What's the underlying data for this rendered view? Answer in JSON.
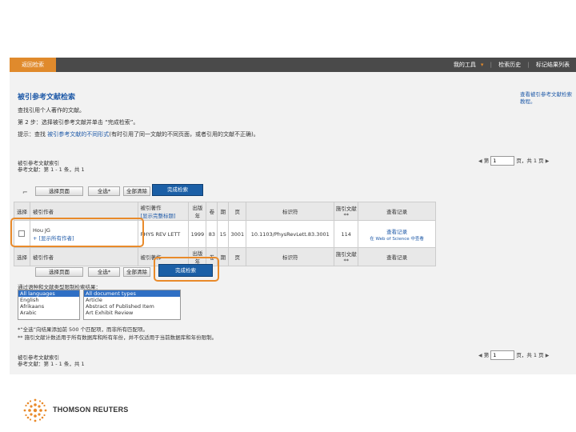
{
  "topbar": {
    "back_label": "返回检索",
    "link_tools": "我的工具",
    "link_history": "检索历史",
    "link_marked": "标记结果列表"
  },
  "page": {
    "title": "被引参考文献检索",
    "help": "查看被引参考文献检索教程。",
    "instructions": {
      "line1": "查找引用个人著作的文献。",
      "line2": "第 2 步：选择被引参考文献并单击 “完成检索”。",
      "line3_prefix": "提示：查找",
      "line3_link": "被引参考文献的不同形式",
      "line3_suffix": "(有时引用了同一文献的不同页面，或者引用的文献不正确)。"
    }
  },
  "counts": {
    "line1": "被引参考文献索引",
    "line2": "参考文献：第 1 - 1 条，共 1"
  },
  "pager": {
    "prefix": "第",
    "page": "1",
    "middle": "页，共 1 页"
  },
  "buttons": {
    "select_page": "选择页面",
    "select_all": "全选*",
    "clear_all": "全部清除",
    "finish": "完成检索"
  },
  "table": {
    "headers": {
      "select": "选择",
      "cited_author": "被引作者",
      "cited_work": "被引著作",
      "show_full": "[显示完整标题]",
      "year": "出版年",
      "volume": "卷",
      "issue": "期",
      "page": "页",
      "identifier": "标识符",
      "citing": "施引文献 **",
      "view_record": "查看记录"
    },
    "row": {
      "author": "Hou JG",
      "more_authors": "+ [显示所有作者]",
      "work": "PHYS REV LETT",
      "year": "1999",
      "volume": "83",
      "issue": "15",
      "page": "3001",
      "doi": "10.1103/PhysRevLett.83.3001",
      "citing_count": "114",
      "view_record": "查看记录",
      "view_source": "在 Web of Science 中查看"
    }
  },
  "filters": {
    "label": "通过语种和文献类型限制检索结果：",
    "languages": [
      "All languages",
      "English",
      "Afrikaans",
      "Arabic"
    ],
    "doc_types": [
      "All document types",
      "Article",
      "Abstract of Published Item",
      "Art Exhibit Review"
    ]
  },
  "notes": {
    "note1": "*“全选”向结果添加前 500 个匹配项，而非所有匹配项。",
    "note2": "** 施引文献计数适用于所有数据库和所有年份，并不仅适用于当前数据库和年份限制。"
  },
  "brand": {
    "name": "THOMSON REUTERS",
    "accent": "#e98a2a",
    "link_color": "#1f5aa8",
    "button_color": "#1b5fa6"
  }
}
